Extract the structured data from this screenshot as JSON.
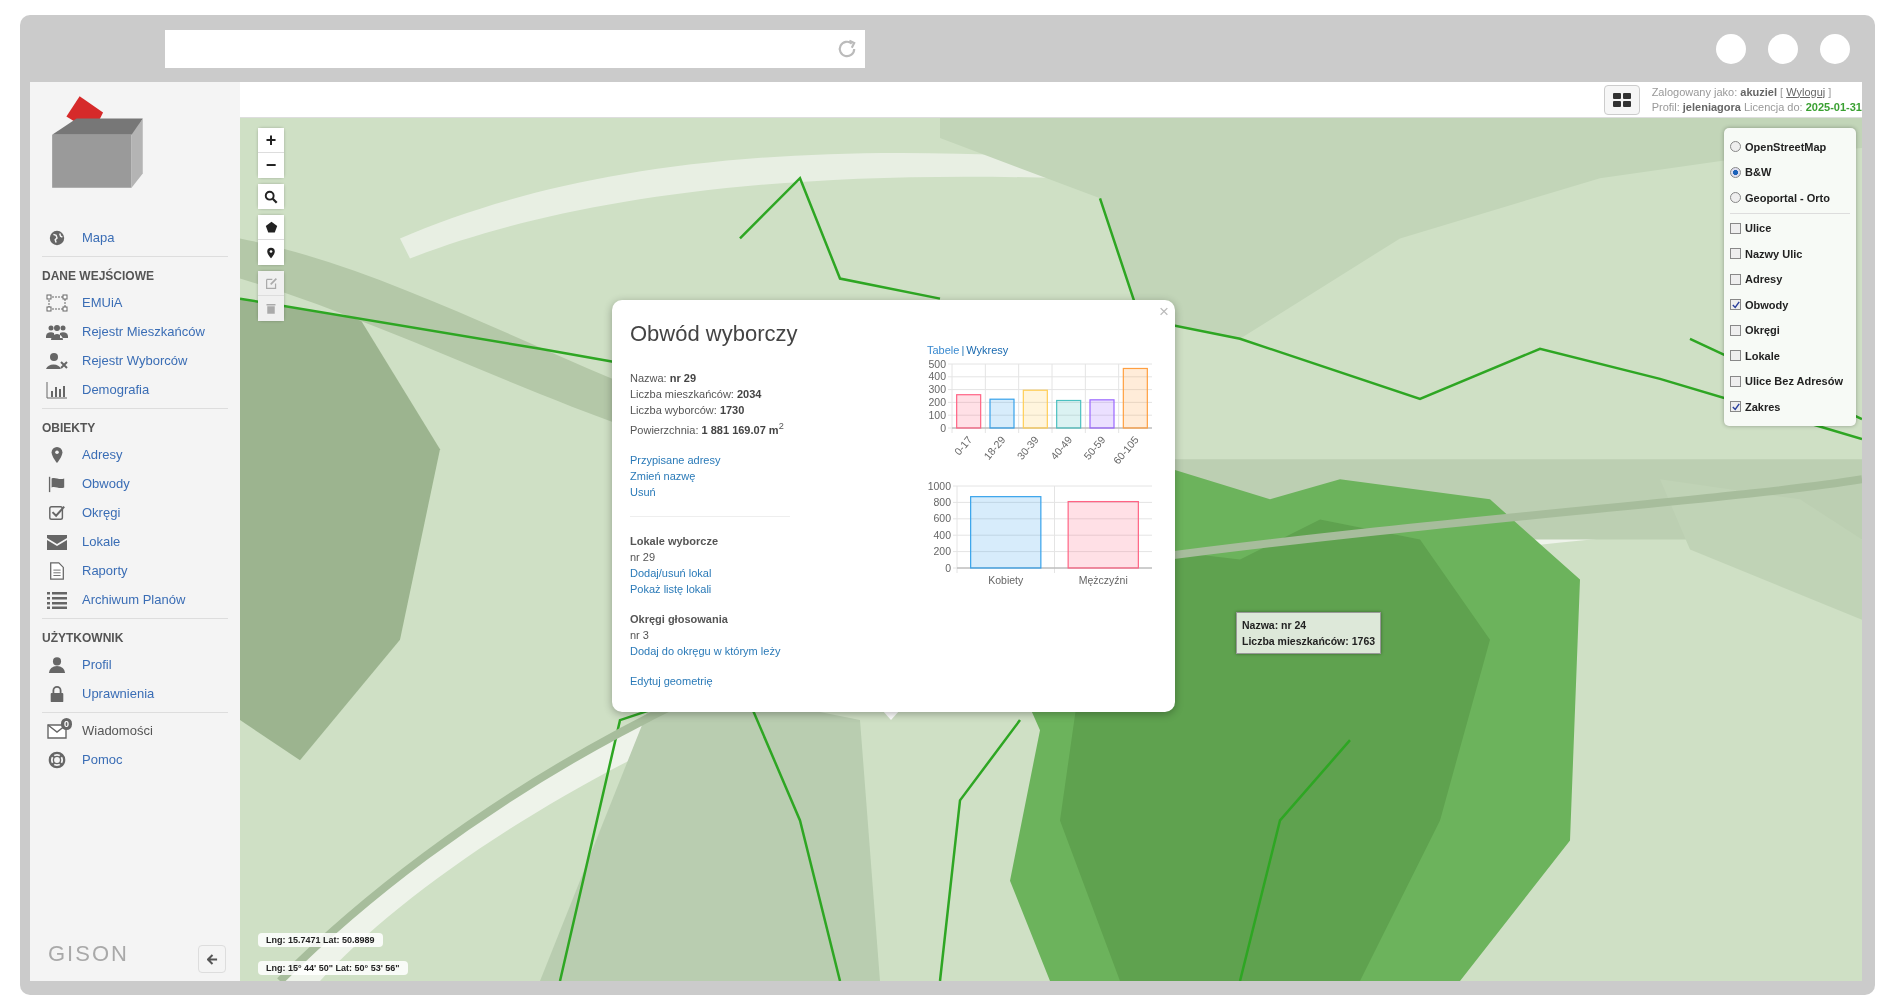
{
  "header": {
    "user_text": "Zalogowany jako: **akuziel** [",
    "logout": "Wyloguj",
    "user_text_end": "]",
    "profile_text": "Profil: **jeleniagora** Licencja do:",
    "license": "2025-01-31"
  },
  "sidebar": {
    "sections": [
      {
        "items": [
          {
            "kind": "link",
            "label": "Mapa"
          }
        ]
      },
      {
        "title": "DANE WEJŚCIOWE",
        "items": [
          {
            "kind": "link",
            "label": "EMUiA"
          },
          {
            "kind": "link",
            "label": "Rejestr Mieszkańców"
          },
          {
            "kind": "link",
            "label": "Rejestr Wyborców"
          },
          {
            "kind": "link",
            "label": "Demografia"
          }
        ]
      },
      {
        "title": "OBIEKTY",
        "items": [
          {
            "kind": "link",
            "label": "Adresy"
          },
          {
            "kind": "link",
            "label": "Obwody"
          },
          {
            "kind": "link",
            "label": "Okręgi"
          },
          {
            "kind": "link",
            "label": "Lokale"
          },
          {
            "kind": "link",
            "label": "Raporty"
          },
          {
            "kind": "link",
            "label": "Archiwum Planów"
          }
        ]
      },
      {
        "title": "UŻYTKOWNIK",
        "items": [
          {
            "kind": "link",
            "label": "Profil"
          },
          {
            "kind": "link",
            "label": "Uprawnienia"
          }
        ]
      },
      {
        "items": [
          {
            "kind": "message",
            "label": "Wiadomości",
            "badge": "0"
          },
          {
            "kind": "link",
            "label": "Pomoc"
          }
        ]
      }
    ],
    "brand": "GISON"
  },
  "map": {
    "zoom_in": "+",
    "zoom_out": "−",
    "tools": [
      {
        "kind": "search",
        "disabled": false
      },
      {
        "kind": "polygon",
        "disabled": false
      },
      {
        "kind": "marker",
        "disabled": false
      },
      {
        "kind": "edit",
        "disabled": true
      },
      {
        "kind": "delete",
        "disabled": true
      }
    ],
    "layers": {
      "base": [
        {
          "label": "OpenStreetMap",
          "selected": false
        },
        {
          "label": "B&W",
          "selected": true
        },
        {
          "label": "Geoportal - Orto",
          "selected": false
        }
      ],
      "overlays": [
        {
          "label": "Ulice",
          "checked": false
        },
        {
          "label": "Nazwy Ulic",
          "checked": false
        },
        {
          "label": "Adresy",
          "checked": false
        },
        {
          "label": "Obwody",
          "checked": true
        },
        {
          "label": "Okręgi",
          "checked": false
        },
        {
          "label": "Lokale",
          "checked": false
        },
        {
          "label": "Ulice Bez Adresów",
          "checked": false
        },
        {
          "label": "Zakres",
          "checked": true
        }
      ]
    },
    "coordinates": [
      "Lng: 15.7471 Lat: 50.8989",
      "Lng: 15° 44' 50\" Lat: 50° 53' 56\""
    ],
    "tooltip": [
      "Nazwa: nr 24",
      "Liczba mieszkańców: 1763"
    ]
  },
  "popup": {
    "title": "Obwód wyborczy",
    "close": "×",
    "info": [
      "Nazwa: **nr 29**",
      "Liczba mieszkańców: **2034**",
      "Liczba wyborców: **1730**",
      "Powierzchnia: **1 881 169.07 m**$^{2}$"
    ],
    "actions": [
      "Przypisane adresy",
      "Zmień nazwę",
      "Usuń"
    ],
    "groups": [
      {
        "title": "Lokale wyborcze",
        "value": "nr 29",
        "links": [
          "Dodaj/usuń lokal",
          "Pokaż listę lokali"
        ]
      },
      {
        "title": "Okręgi głosowania",
        "value": "nr 3",
        "links": [
          "Dodaj do okręgu w którym leży"
        ]
      }
    ],
    "edit_link": "Edytuj geometrię",
    "view_tabs": [
      {
        "label": "Tabele",
        "selected": false
      },
      {
        "label": "Wykresy",
        "selected": true
      }
    ],
    "tab_separator": "|",
    "age_chart": {
      "chart_data": {
        "type": "bar",
        "categories": [
          "0-17",
          "18-29",
          "30-39",
          "40-49",
          "50-59",
          "60-105"
        ],
        "values": [
          260,
          225,
          295,
          215,
          220,
          465
        ],
        "colors": [
          "#ff6384",
          "#36a2eb",
          "#ffce56",
          "#4bc0c0",
          "#9966ff",
          "#ff9f40"
        ],
        "grid": true,
        "ylim": [
          0,
          500
        ],
        "yticks": [
          0,
          100,
          200,
          300,
          400,
          500
        ]
      }
    },
    "gender_chart": {
      "chart_data": {
        "type": "bar",
        "categories": [
          "Kobiety",
          "Mężczyźni"
        ],
        "values": [
          870,
          810
        ],
        "colors": [
          "#36a2eb",
          "#ff6384"
        ],
        "grid": true,
        "ylim": [
          0,
          1000
        ],
        "yticks": [
          0,
          200,
          400,
          600,
          800,
          1000
        ]
      }
    }
  }
}
